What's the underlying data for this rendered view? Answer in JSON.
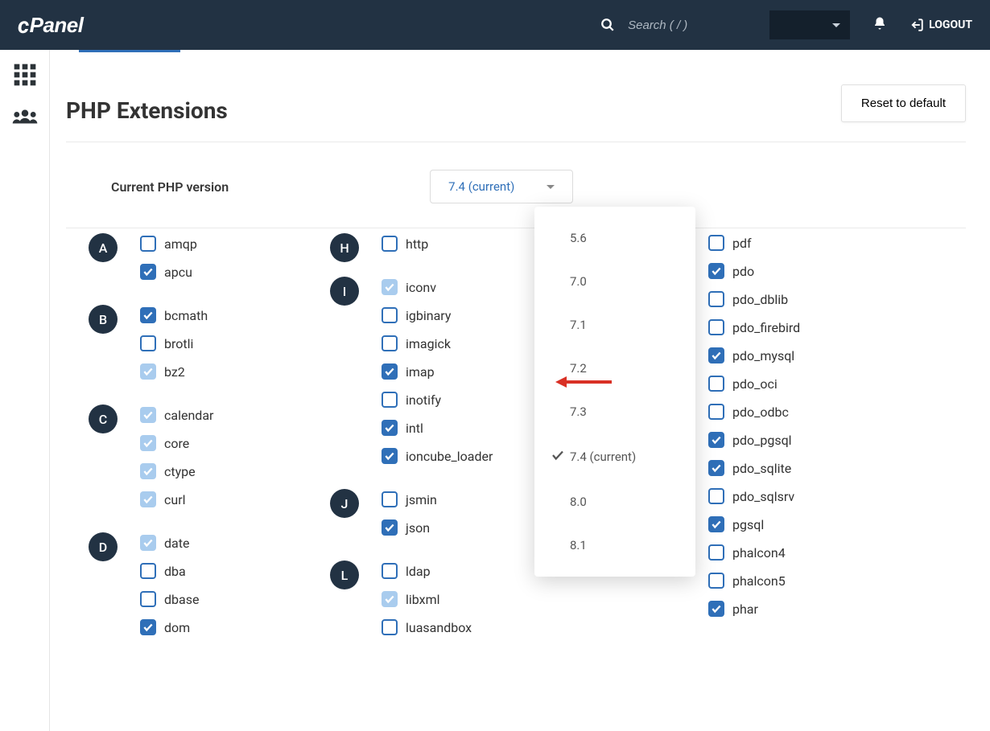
{
  "header": {
    "brand": "cPanel",
    "search_placeholder": "Search ( / )",
    "logout": "LOGOUT"
  },
  "page": {
    "title": "PHP Extensions",
    "reset_button": "Reset to default",
    "version_label": "Current PHP version",
    "version_selected": "7.4 (current)"
  },
  "dropdown": {
    "items": [
      {
        "label": "5.6",
        "selected": false
      },
      {
        "label": "7.0",
        "selected": false
      },
      {
        "label": "7.1",
        "selected": false
      },
      {
        "label": "7.2",
        "selected": false
      },
      {
        "label": "7.3",
        "selected": false
      },
      {
        "label": "7.4 (current)",
        "selected": true
      },
      {
        "label": "8.0",
        "selected": false
      },
      {
        "label": "8.1",
        "selected": false
      }
    ]
  },
  "ext": {
    "col1": [
      {
        "letter": "A",
        "items": [
          {
            "label": "amqp",
            "state": "unchecked"
          },
          {
            "label": "apcu",
            "state": "checked"
          }
        ]
      },
      {
        "letter": "B",
        "items": [
          {
            "label": "bcmath",
            "state": "checked"
          },
          {
            "label": "brotli",
            "state": "unchecked"
          },
          {
            "label": "bz2",
            "state": "soft"
          }
        ]
      },
      {
        "letter": "C",
        "items": [
          {
            "label": "calendar",
            "state": "soft"
          },
          {
            "label": "core",
            "state": "soft"
          },
          {
            "label": "ctype",
            "state": "soft"
          },
          {
            "label": "curl",
            "state": "soft"
          }
        ]
      },
      {
        "letter": "D",
        "items": [
          {
            "label": "date",
            "state": "soft"
          },
          {
            "label": "dba",
            "state": "unchecked"
          },
          {
            "label": "dbase",
            "state": "unchecked"
          },
          {
            "label": "dom",
            "state": "checked"
          }
        ]
      }
    ],
    "col2": [
      {
        "letter": "H",
        "items": [
          {
            "label": "http",
            "state": "unchecked"
          }
        ]
      },
      {
        "letter": "I",
        "items": [
          {
            "label": "iconv",
            "state": "soft"
          },
          {
            "label": "igbinary",
            "state": "unchecked"
          },
          {
            "label": "imagick",
            "state": "unchecked"
          },
          {
            "label": "imap",
            "state": "checked"
          },
          {
            "label": "inotify",
            "state": "unchecked"
          },
          {
            "label": "intl",
            "state": "checked"
          },
          {
            "label": "ioncube_loader",
            "state": "checked"
          }
        ]
      },
      {
        "letter": "J",
        "items": [
          {
            "label": "jsmin",
            "state": "unchecked"
          },
          {
            "label": "json",
            "state": "checked"
          }
        ]
      },
      {
        "letter": "L",
        "items": [
          {
            "label": "ldap",
            "state": "unchecked"
          },
          {
            "label": "libxml",
            "state": "soft"
          },
          {
            "label": "luasandbox",
            "state": "unchecked"
          }
        ]
      }
    ],
    "col3": [
      {
        "label": "pdf",
        "state": "unchecked"
      },
      {
        "label": "pdo",
        "state": "checked"
      },
      {
        "label": "pdo_dblib",
        "state": "unchecked"
      },
      {
        "label": "pdo_firebird",
        "state": "unchecked"
      },
      {
        "label": "pdo_mysql",
        "state": "checked"
      },
      {
        "label": "pdo_oci",
        "state": "unchecked"
      },
      {
        "label": "pdo_odbc",
        "state": "unchecked"
      },
      {
        "label": "pdo_pgsql",
        "state": "checked"
      },
      {
        "label": "pdo_sqlite",
        "state": "checked"
      },
      {
        "label": "pdo_sqlsrv",
        "state": "unchecked"
      },
      {
        "label": "pgsql",
        "state": "checked"
      },
      {
        "label": "phalcon4",
        "state": "unchecked"
      },
      {
        "label": "phalcon5",
        "state": "unchecked"
      },
      {
        "label": "phar",
        "state": "checked"
      }
    ]
  }
}
